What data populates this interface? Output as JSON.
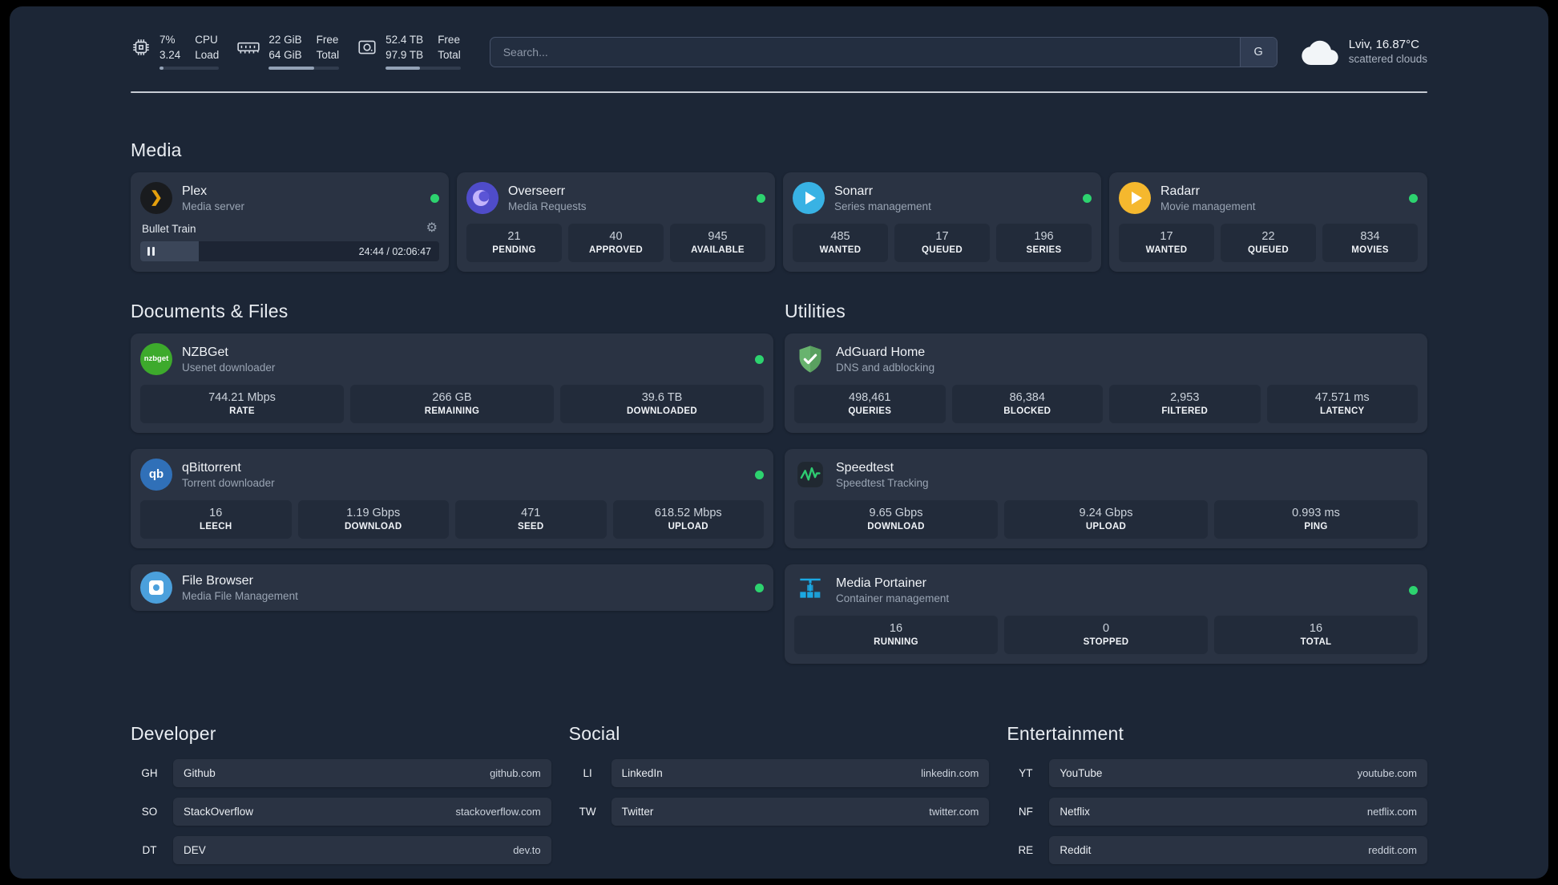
{
  "colors": {
    "background": "#1c2636",
    "card": "#2a3343",
    "stat_tile": "#222b3a",
    "status_online": "#2dd36f",
    "plex_brand": "#e5a00d",
    "overseerr_brand": "#4f4cc9",
    "sonarr_brand": "#38b2e4",
    "radarr_brand": "#f5b82e",
    "nzbget_brand": "#3daa2c",
    "qbittorrent_brand": "#3070b8",
    "filebrowser_brand": "#4ba0dc",
    "adguard_brand": "#68b36e",
    "speedtest_accent": "#2ecc71",
    "portainer_brand": "#1ba8e3"
  },
  "topbar": {
    "cpu": {
      "value_top": "7%",
      "value_bottom": "3.24",
      "label_top": "CPU",
      "label_bottom": "Load",
      "progress": 7
    },
    "memory": {
      "value_top": "22 GiB",
      "value_bottom": "64 GiB",
      "label_top": "Free",
      "label_bottom": "Total",
      "progress": 65
    },
    "disk": {
      "value_top": "52.4 TB",
      "value_bottom": "97.9 TB",
      "label_top": "Free",
      "label_bottom": "Total",
      "progress": 46
    },
    "search": {
      "placeholder": "Search...",
      "engine_button": "G"
    },
    "weather": {
      "location": "Lviv, 16.87°C",
      "condition": "scattered clouds"
    }
  },
  "section_titles": {
    "media": "Media",
    "documents": "Documents & Files",
    "utilities": "Utilities",
    "developer": "Developer",
    "social": "Social",
    "entertainment": "Entertainment"
  },
  "services": {
    "plex": {
      "name": "Plex",
      "description": "Media server",
      "online": true,
      "now_playing": "Bullet Train",
      "elapsed_total": "24:44 / 02:06:47",
      "progress": 19.5
    },
    "overseerr": {
      "name": "Overseerr",
      "description": "Media Requests",
      "online": true,
      "stats": [
        {
          "value": "21",
          "label": "PENDING"
        },
        {
          "value": "40",
          "label": "APPROVED"
        },
        {
          "value": "945",
          "label": "AVAILABLE"
        }
      ]
    },
    "sonarr": {
      "name": "Sonarr",
      "description": "Series management",
      "online": true,
      "stats": [
        {
          "value": "485",
          "label": "WANTED"
        },
        {
          "value": "17",
          "label": "QUEUED"
        },
        {
          "value": "196",
          "label": "SERIES"
        }
      ]
    },
    "radarr": {
      "name": "Radarr",
      "description": "Movie management",
      "online": true,
      "stats": [
        {
          "value": "17",
          "label": "WANTED"
        },
        {
          "value": "22",
          "label": "QUEUED"
        },
        {
          "value": "834",
          "label": "MOVIES"
        }
      ]
    },
    "nzbget": {
      "name": "NZBGet",
      "description": "Usenet downloader",
      "online": true,
      "icon_text": "nzbget",
      "stats": [
        {
          "value": "744.21 Mbps",
          "label": "RATE"
        },
        {
          "value": "266 GB",
          "label": "REMAINING"
        },
        {
          "value": "39.6 TB",
          "label": "DOWNLOADED"
        }
      ]
    },
    "qbittorrent": {
      "name": "qBittorrent",
      "description": "Torrent downloader",
      "online": true,
      "icon_text": "qb",
      "stats": [
        {
          "value": "16",
          "label": "LEECH"
        },
        {
          "value": "1.19 Gbps",
          "label": "DOWNLOAD"
        },
        {
          "value": "471",
          "label": "SEED"
        },
        {
          "value": "618.52 Mbps",
          "label": "UPLOAD"
        }
      ]
    },
    "filebrowser": {
      "name": "File Browser",
      "description": "Media File Management",
      "online": true
    },
    "adguard": {
      "name": "AdGuard Home",
      "description": "DNS and adblocking",
      "online": false,
      "stats": [
        {
          "value": "498,461",
          "label": "QUERIES"
        },
        {
          "value": "86,384",
          "label": "BLOCKED"
        },
        {
          "value": "2,953",
          "label": "FILTERED"
        },
        {
          "value": "47.571 ms",
          "label": "LATENCY"
        }
      ]
    },
    "speedtest": {
      "name": "Speedtest",
      "description": "Speedtest Tracking",
      "online": false,
      "stats": [
        {
          "value": "9.65 Gbps",
          "label": "DOWNLOAD"
        },
        {
          "value": "9.24 Gbps",
          "label": "UPLOAD"
        },
        {
          "value": "0.993 ms",
          "label": "PING"
        }
      ]
    },
    "portainer": {
      "name": "Media Portainer",
      "description": "Container management",
      "online": true,
      "stats": [
        {
          "value": "16",
          "label": "RUNNING"
        },
        {
          "value": "0",
          "label": "STOPPED"
        },
        {
          "value": "16",
          "label": "TOTAL"
        }
      ]
    }
  },
  "bookmarks": {
    "developer": [
      {
        "abbr": "GH",
        "name": "Github",
        "url": "github.com"
      },
      {
        "abbr": "SO",
        "name": "StackOverflow",
        "url": "stackoverflow.com"
      },
      {
        "abbr": "DT",
        "name": "DEV",
        "url": "dev.to"
      }
    ],
    "social": [
      {
        "abbr": "LI",
        "name": "LinkedIn",
        "url": "linkedin.com"
      },
      {
        "abbr": "TW",
        "name": "Twitter",
        "url": "twitter.com"
      }
    ],
    "entertainment": [
      {
        "abbr": "YT",
        "name": "YouTube",
        "url": "youtube.com"
      },
      {
        "abbr": "NF",
        "name": "Netflix",
        "url": "netflix.com"
      },
      {
        "abbr": "RE",
        "name": "Reddit",
        "url": "reddit.com"
      }
    ]
  }
}
